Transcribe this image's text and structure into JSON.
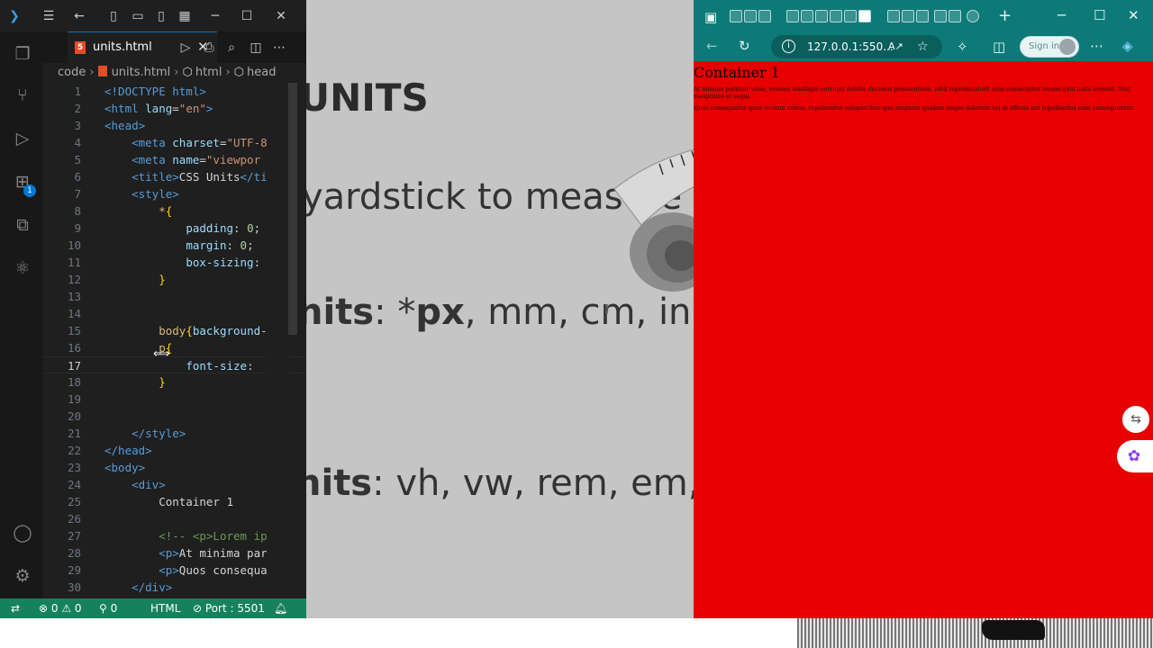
{
  "vscode": {
    "active_tab": "units.html",
    "breadcrumb": [
      "code",
      "units.html",
      "html",
      "head"
    ],
    "current_line": 17,
    "lines": [
      {
        "n": "1",
        "parts": [
          {
            "c": "tag",
            "t": "<!DOCTYPE html>"
          }
        ]
      },
      {
        "n": "2",
        "parts": [
          {
            "c": "tag",
            "t": "<html "
          },
          {
            "c": "attr",
            "t": "lang"
          },
          {
            "c": "txt",
            "t": "="
          },
          {
            "c": "str",
            "t": "\"en\""
          },
          {
            "c": "tag",
            "t": ">"
          }
        ]
      },
      {
        "n": "3",
        "parts": [
          {
            "c": "tag",
            "t": "<head>"
          }
        ]
      },
      {
        "n": "4",
        "parts": [
          {
            "c": "txt",
            "t": "    "
          },
          {
            "c": "tag",
            "t": "<meta "
          },
          {
            "c": "attr",
            "t": "charset"
          },
          {
            "c": "txt",
            "t": "="
          },
          {
            "c": "str",
            "t": "\"UTF-8"
          }
        ]
      },
      {
        "n": "5",
        "parts": [
          {
            "c": "txt",
            "t": "    "
          },
          {
            "c": "tag",
            "t": "<meta "
          },
          {
            "c": "attr",
            "t": "name"
          },
          {
            "c": "txt",
            "t": "="
          },
          {
            "c": "str",
            "t": "\"viewpor"
          }
        ]
      },
      {
        "n": "6",
        "parts": [
          {
            "c": "txt",
            "t": "    "
          },
          {
            "c": "tag",
            "t": "<title>"
          },
          {
            "c": "txt",
            "t": "CSS Units"
          },
          {
            "c": "tag",
            "t": "</ti"
          }
        ]
      },
      {
        "n": "7",
        "parts": [
          {
            "c": "txt",
            "t": "    "
          },
          {
            "c": "tag",
            "t": "<style>"
          }
        ]
      },
      {
        "n": "8",
        "parts": [
          {
            "c": "txt",
            "t": "        "
          },
          {
            "c": "sel",
            "t": "*"
          },
          {
            "c": "brk",
            "t": "{"
          }
        ]
      },
      {
        "n": "9",
        "parts": [
          {
            "c": "txt",
            "t": "            "
          },
          {
            "c": "prop",
            "t": "padding"
          },
          {
            "c": "txt",
            "t": ": "
          },
          {
            "c": "num",
            "t": "0"
          },
          {
            "c": "txt",
            "t": ";"
          }
        ]
      },
      {
        "n": "10",
        "parts": [
          {
            "c": "txt",
            "t": "            "
          },
          {
            "c": "prop",
            "t": "margin"
          },
          {
            "c": "txt",
            "t": ": "
          },
          {
            "c": "num",
            "t": "0"
          },
          {
            "c": "txt",
            "t": ";"
          }
        ]
      },
      {
        "n": "11",
        "parts": [
          {
            "c": "txt",
            "t": "            "
          },
          {
            "c": "prop",
            "t": "box-sizing"
          },
          {
            "c": "txt",
            "t": ":"
          }
        ]
      },
      {
        "n": "12",
        "parts": [
          {
            "c": "txt",
            "t": "        "
          },
          {
            "c": "brk",
            "t": "}"
          }
        ]
      },
      {
        "n": "13",
        "parts": []
      },
      {
        "n": "14",
        "parts": []
      },
      {
        "n": "15",
        "parts": [
          {
            "c": "txt",
            "t": "        "
          },
          {
            "c": "sel",
            "t": "body"
          },
          {
            "c": "brk",
            "t": "{"
          },
          {
            "c": "prop",
            "t": "background-"
          }
        ]
      },
      {
        "n": "16",
        "parts": [
          {
            "c": "txt",
            "t": "        "
          },
          {
            "c": "sel",
            "t": "p"
          },
          {
            "c": "brk",
            "t": "{"
          }
        ]
      },
      {
        "n": "17",
        "parts": [
          {
            "c": "txt",
            "t": "            "
          },
          {
            "c": "prop",
            "t": "font-size"
          },
          {
            "c": "txt",
            "t": ": "
          }
        ]
      },
      {
        "n": "18",
        "parts": [
          {
            "c": "txt",
            "t": "        "
          },
          {
            "c": "brk",
            "t": "}"
          }
        ]
      },
      {
        "n": "19",
        "parts": []
      },
      {
        "n": "20",
        "parts": []
      },
      {
        "n": "21",
        "parts": [
          {
            "c": "txt",
            "t": "    "
          },
          {
            "c": "tag",
            "t": "</style>"
          }
        ]
      },
      {
        "n": "22",
        "parts": [
          {
            "c": "tag",
            "t": "</head>"
          }
        ]
      },
      {
        "n": "23",
        "parts": [
          {
            "c": "tag",
            "t": "<body>"
          }
        ]
      },
      {
        "n": "24",
        "parts": [
          {
            "c": "txt",
            "t": "    "
          },
          {
            "c": "tag",
            "t": "<div>"
          }
        ]
      },
      {
        "n": "25",
        "parts": [
          {
            "c": "txt",
            "t": "        Container 1"
          }
        ]
      },
      {
        "n": "26",
        "parts": []
      },
      {
        "n": "27",
        "parts": [
          {
            "c": "txt",
            "t": "        "
          },
          {
            "c": "com",
            "t": "<!-- <p>Lorem ip"
          }
        ]
      },
      {
        "n": "28",
        "parts": [
          {
            "c": "txt",
            "t": "        "
          },
          {
            "c": "tag",
            "t": "<p>"
          },
          {
            "c": "txt",
            "t": "At minima par"
          }
        ]
      },
      {
        "n": "29",
        "parts": [
          {
            "c": "txt",
            "t": "        "
          },
          {
            "c": "tag",
            "t": "<p>"
          },
          {
            "c": "txt",
            "t": "Quos consequa"
          }
        ]
      },
      {
        "n": "30",
        "parts": [
          {
            "c": "txt",
            "t": "    "
          },
          {
            "c": "tag",
            "t": "</div>"
          }
        ]
      }
    ],
    "status": {
      "errors": "0",
      "warnings": "0",
      "ports": "0",
      "language": "HTML",
      "port": "Port : 5501"
    }
  },
  "slide": {
    "title": "UNITS",
    "line1": "yardstick to measure",
    "line2_bold": "nits",
    "line2_rest": ": *",
    "line2_px": "px",
    "line2_tail": ", mm, cm, in",
    "line3_bold": "nits",
    "line3_rest": ": vh, vw, rem, em,"
  },
  "browser": {
    "address": "127.0.0.1:550...",
    "signin_label": "Sign in",
    "page": {
      "background": "#e60000",
      "heading": "Container 1",
      "paragraph1": "At minima pariatur vitae, eveniet similique corrupti debitis ducimus praesentium, nihil reprehenderit cum consectetur rerum quia nulla eveniet. Nisi voluptates et sequi.",
      "paragraph2": "Quos consequatur quas veniam minus, repellendus voluptatibus quo magnam quidem neque dolorum vel in officiis aut repellendus eum consequuntur."
    }
  },
  "colors": {
    "vscode_status": "#16825d",
    "edge_chrome": "#0d7a78",
    "slide_bg": "#c5c5c5"
  }
}
